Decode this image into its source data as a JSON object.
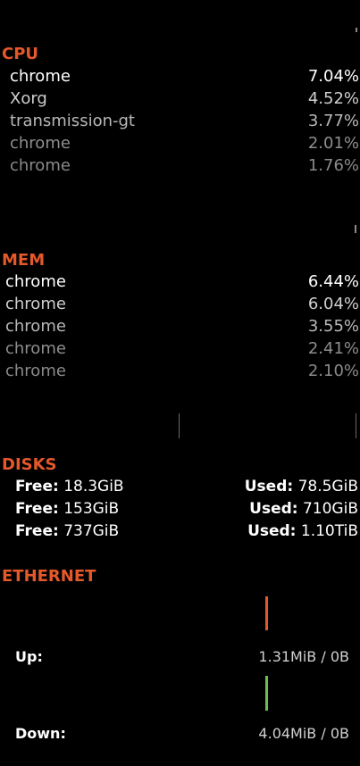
{
  "colors": {
    "accent": "#e4582a",
    "up_bar": "#e4582a",
    "down_bar": "#6cbf4f",
    "text_primary": "#ffffff",
    "text_dim": "#8a8a8a"
  },
  "cpu": {
    "title": "CPU",
    "processes": [
      {
        "name": "chrome",
        "value": "7.04%"
      },
      {
        "name": "Xorg",
        "value": "4.52%"
      },
      {
        "name": "transmission-gt",
        "value": "3.77%"
      },
      {
        "name": "chrome",
        "value": "2.01%"
      },
      {
        "name": "chrome",
        "value": "1.76%"
      }
    ]
  },
  "mem": {
    "title": "MEM",
    "processes": [
      {
        "name": "chrome",
        "value": "6.44%"
      },
      {
        "name": "chrome",
        "value": "6.04%"
      },
      {
        "name": "chrome",
        "value": "3.55%"
      },
      {
        "name": "chrome",
        "value": "2.41%"
      },
      {
        "name": "chrome",
        "value": "2.10%"
      }
    ]
  },
  "disks": {
    "title": "DISKS",
    "free_label": "Free:",
    "used_label": "Used:",
    "items": [
      {
        "free": "18.3GiB",
        "used": "78.5GiB"
      },
      {
        "free": "153GiB",
        "used": "710GiB"
      },
      {
        "free": "737GiB",
        "used": "1.10TiB"
      }
    ]
  },
  "ethernet": {
    "title": "ETHERNET",
    "up_label": "Up:",
    "up_value": "1.31MiB / 0B",
    "down_label": "Down:",
    "down_value": "4.04MiB / 0B"
  }
}
